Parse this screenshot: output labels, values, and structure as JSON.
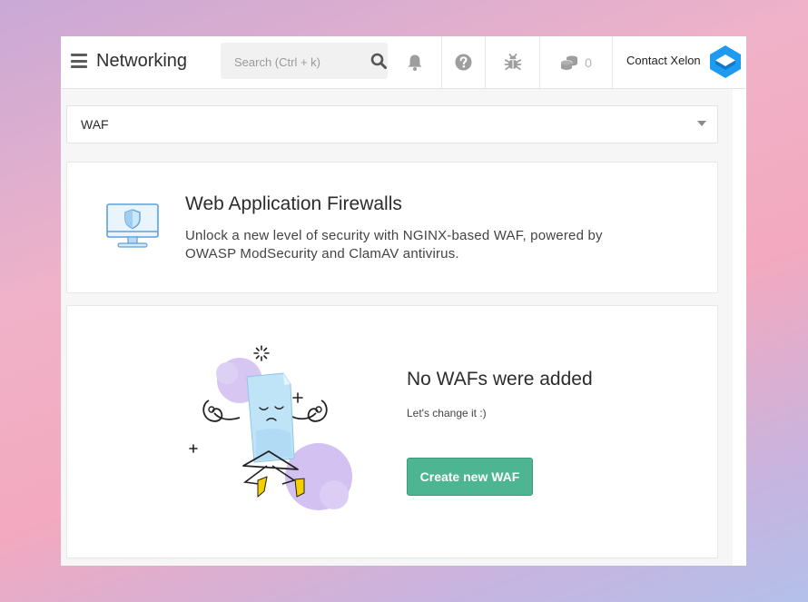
{
  "header": {
    "title": "Networking",
    "menu_icon": "hamburger-icon",
    "search": {
      "placeholder": "Search (Ctrl + k)",
      "value": "",
      "icon": "search-icon"
    },
    "icons": [
      "bell-icon",
      "help-icon",
      "bug-icon",
      "coins-icon"
    ],
    "credits_count": "0",
    "contact_label": "Contact Xelon",
    "logo": "xelon-logo"
  },
  "filter": {
    "selected": "WAF",
    "icon": "chevron-down-icon"
  },
  "info": {
    "title": "Web Application Firewalls",
    "description": "Unlock a new level of security with NGINX-based WAF, powered by OWASP ModSecurity and ClamAV antivirus.",
    "icon": "shield-monitor-icon"
  },
  "empty_state": {
    "title": "No WAFs were added",
    "subtitle": "Let's change it :)",
    "button_label": "Create new WAF",
    "illustration": "meditating-document-illustration"
  },
  "colors": {
    "accent": "#4db592",
    "logo": "#1e9bf0",
    "illustration_blob": "#d7c6f2",
    "illustration_doc": "#bfe3f7",
    "illustration_feet": "#f5d000"
  }
}
